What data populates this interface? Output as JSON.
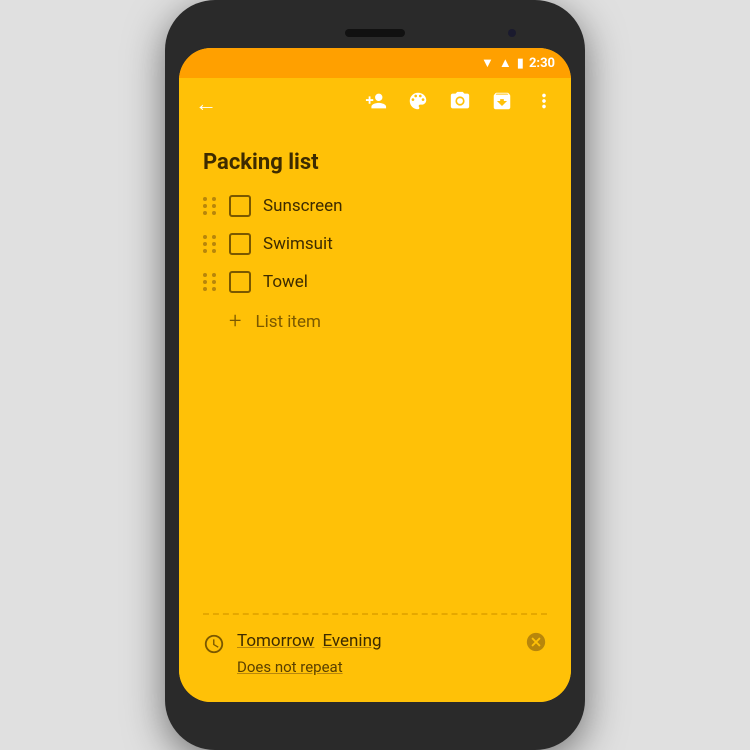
{
  "status_bar": {
    "time": "2:30",
    "wifi_icon": "wifi",
    "signal_icon": "signal",
    "battery_icon": "battery"
  },
  "toolbar": {
    "back_label": "←",
    "add_collaborator_label": "👤+",
    "palette_label": "🎨",
    "camera_label": "📷",
    "archive_label": "⬇",
    "more_label": "⋮"
  },
  "note": {
    "title": "Packing list",
    "items": [
      {
        "text": "Sunscreen",
        "checked": false
      },
      {
        "text": "Swimsuit",
        "checked": false
      },
      {
        "text": "Towel",
        "checked": false
      }
    ],
    "add_item_label": "List item",
    "reminder": {
      "date": "Tomorrow",
      "period": "Evening",
      "repeat": "Does not repeat"
    }
  },
  "colors": {
    "background": "#FFC107",
    "status_bar": "#FFA000",
    "text_dark": "#3d2b00",
    "text_muted": "#7a5800",
    "accent": "#b8860b"
  }
}
